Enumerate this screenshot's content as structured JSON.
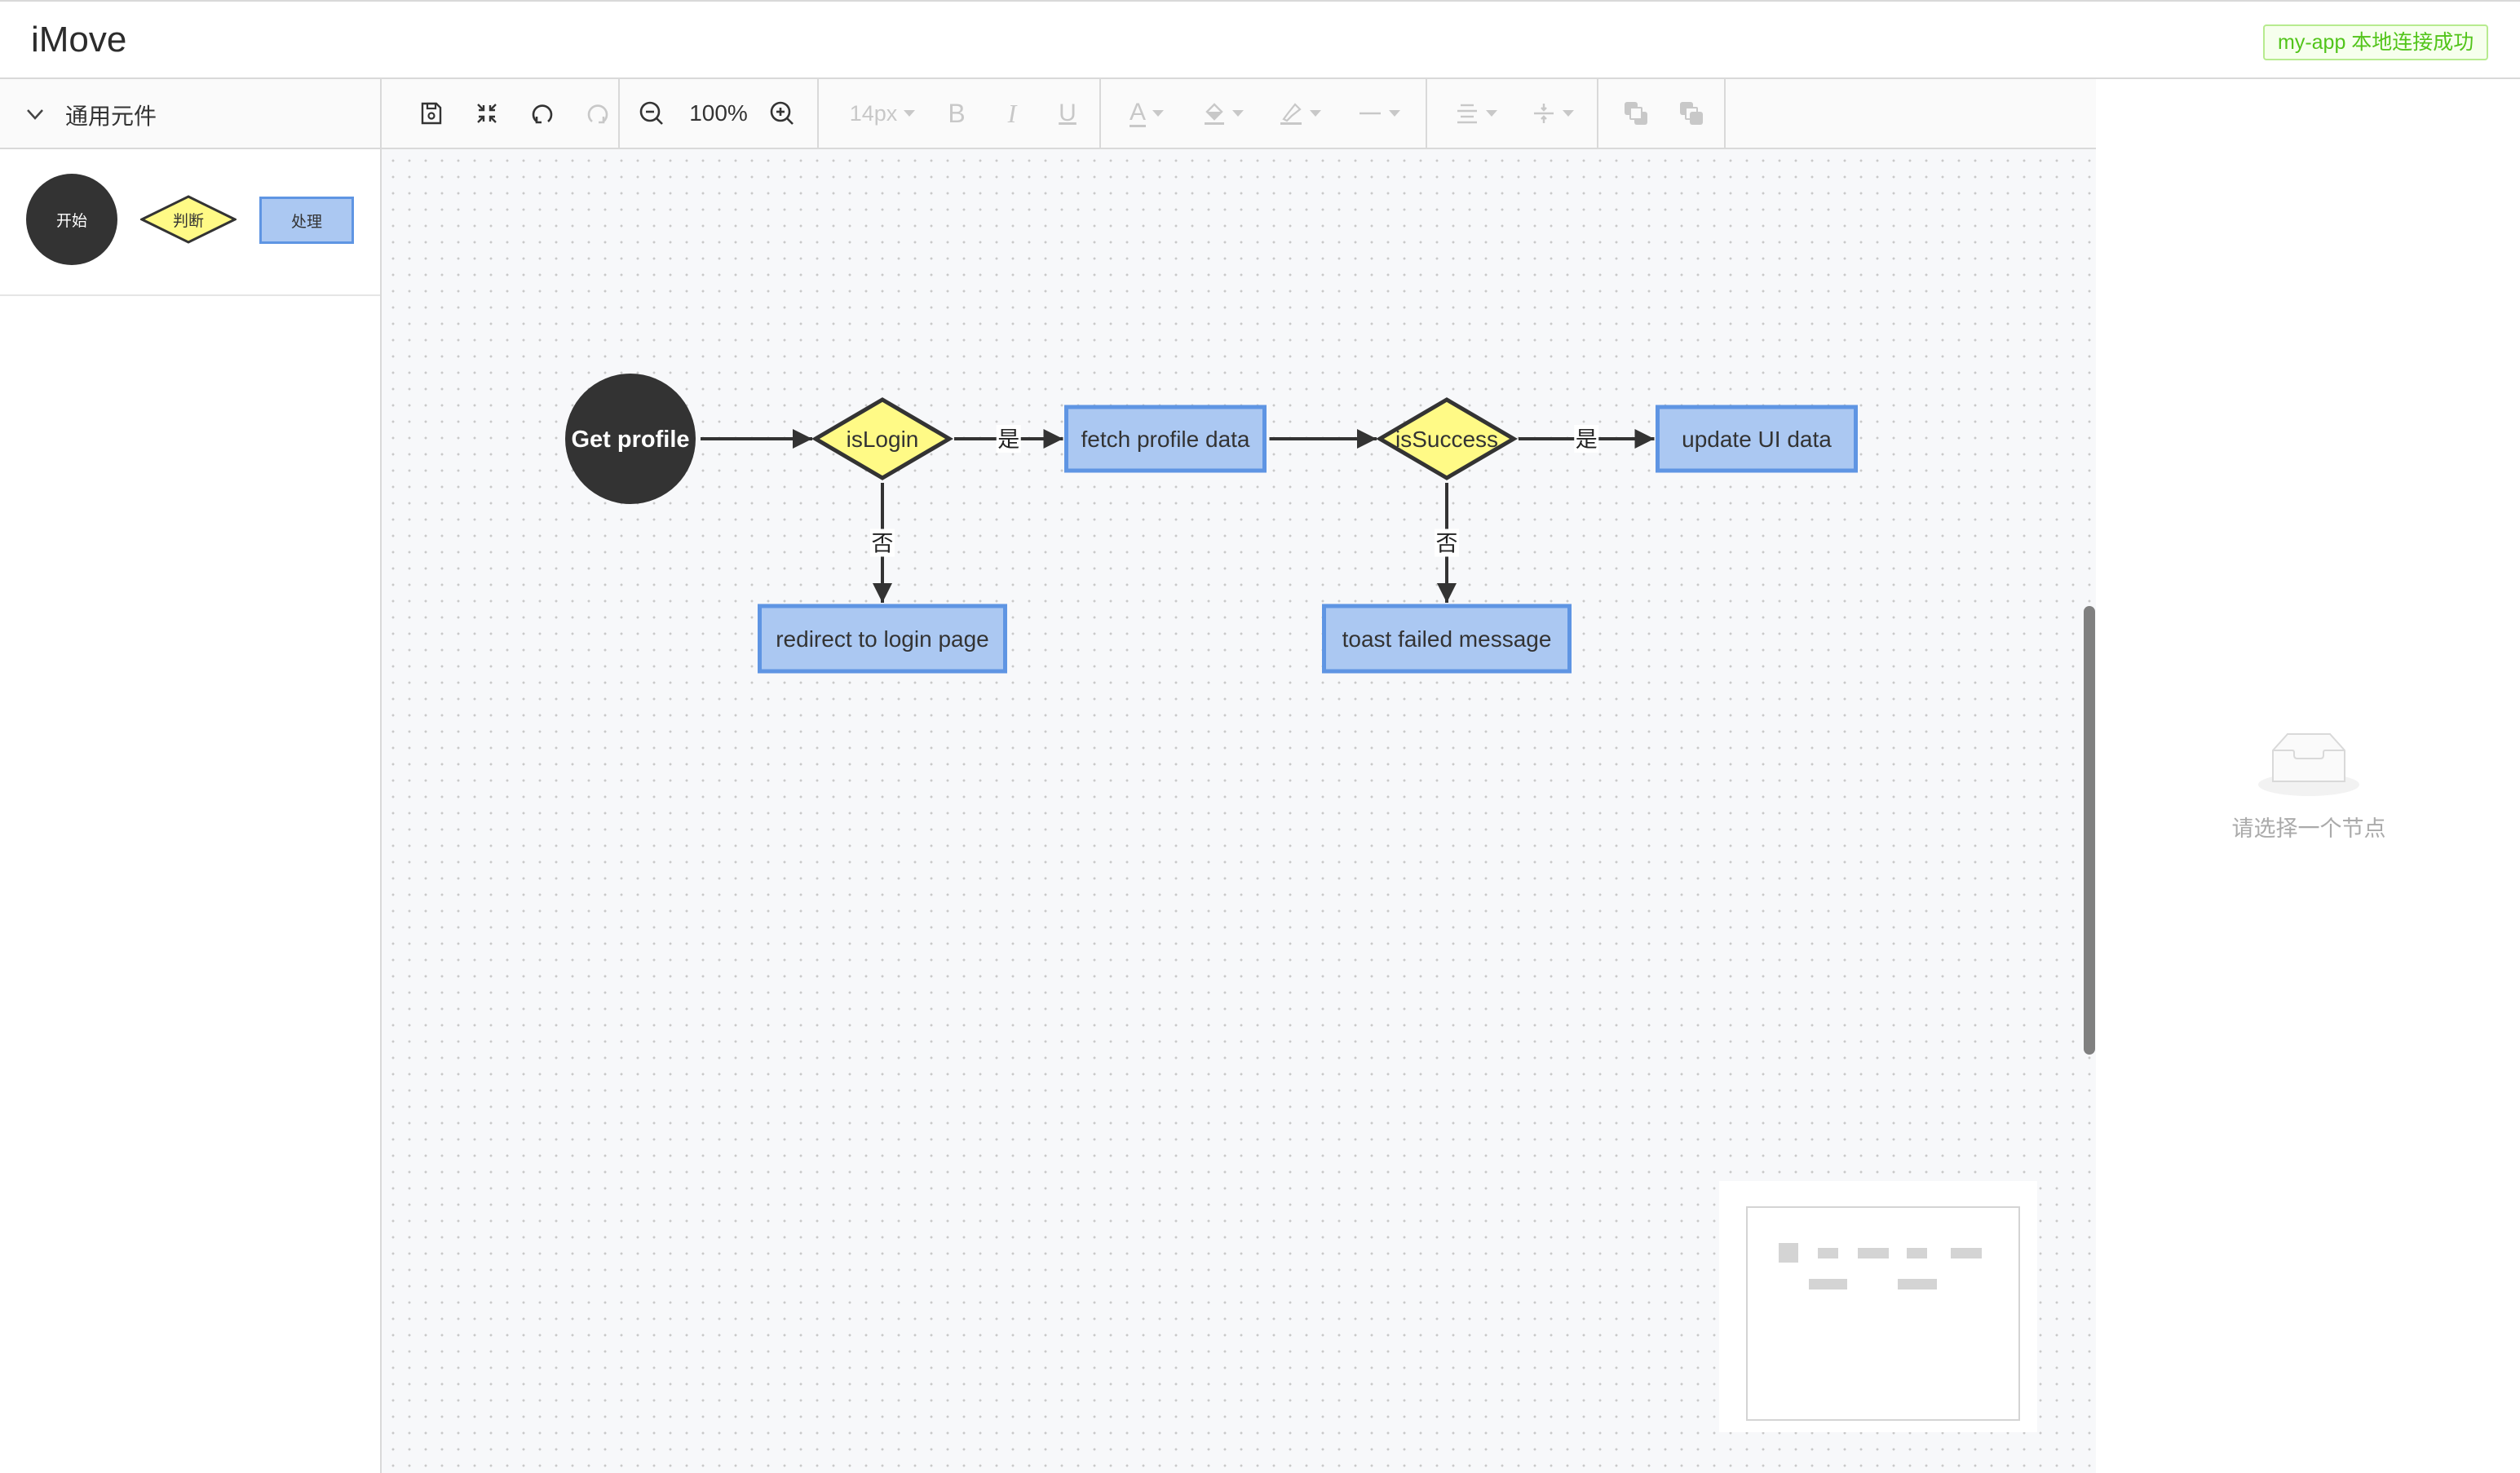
{
  "header": {
    "app_title": "iMove",
    "connection_status": "my-app 本地连接成功",
    "status_color": "#52c41a"
  },
  "sidebar": {
    "panel_title": "通用元件",
    "shapes": [
      {
        "type": "circle",
        "label": "开始"
      },
      {
        "type": "diamond",
        "label": "判断"
      },
      {
        "type": "rect",
        "label": "处理"
      }
    ]
  },
  "toolbar": {
    "save_icon": "save-icon",
    "fit_icon": "fit-canvas-icon",
    "undo_icon": "undo-icon",
    "redo_icon": "redo-icon",
    "zoom_out_icon": "zoom-out-icon",
    "zoom_level": "100%",
    "zoom_in_icon": "zoom-in-icon",
    "font_size": "14px",
    "bold_label": "B",
    "italic_label": "I",
    "underline_label": "U",
    "text_color_label": "A"
  },
  "flowchart": {
    "colors": {
      "start": "#333333",
      "decision": "#fffa86",
      "process": "#abc8f2",
      "process_border": "#5f95e3",
      "edge": "#333333"
    },
    "nodes": [
      {
        "id": "start",
        "type": "circle",
        "label": "Get profile"
      },
      {
        "id": "isLogin",
        "type": "diamond",
        "label": "isLogin"
      },
      {
        "id": "fetch",
        "type": "rect",
        "label": "fetch profile data"
      },
      {
        "id": "isSuccess",
        "type": "diamond",
        "label": "isSuccess"
      },
      {
        "id": "update",
        "type": "rect",
        "label": "update UI data"
      },
      {
        "id": "redirect",
        "type": "rect",
        "label": "redirect to login page"
      },
      {
        "id": "toast",
        "type": "rect",
        "label": "toast failed message"
      }
    ],
    "edges": [
      {
        "from": "start",
        "to": "isLogin",
        "label": ""
      },
      {
        "from": "isLogin",
        "to": "fetch",
        "label": "是"
      },
      {
        "from": "fetch",
        "to": "isSuccess",
        "label": ""
      },
      {
        "from": "isSuccess",
        "to": "update",
        "label": "是"
      },
      {
        "from": "isLogin",
        "to": "redirect",
        "label": "否"
      },
      {
        "from": "isSuccess",
        "to": "toast",
        "label": "否"
      }
    ]
  },
  "right_panel": {
    "empty_text": "请选择一个节点"
  }
}
